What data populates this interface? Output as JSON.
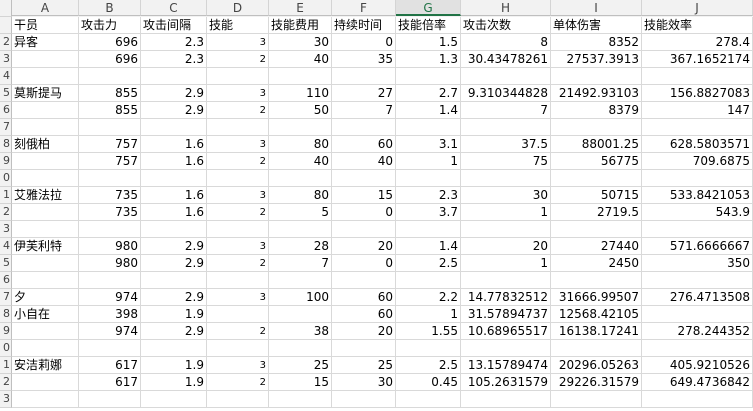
{
  "columns": [
    "A",
    "B",
    "C",
    "D",
    "E",
    "F",
    "G",
    "H",
    "I",
    "J"
  ],
  "selected_column": "G",
  "row_numbers": [
    "",
    "2",
    "3",
    "4",
    "5",
    "6",
    "7",
    "8",
    "9",
    "0",
    "1",
    "2",
    "3",
    "4",
    "5",
    "6",
    "7",
    "8",
    "9",
    "0",
    "1",
    "2",
    "3"
  ],
  "rows": [
    [
      "干员",
      "攻击力",
      "攻击间隔",
      "技能",
      "技能费用",
      "持续时间",
      "技能倍率",
      "攻击次数",
      "单体伤害",
      "技能效率"
    ],
    [
      "异客",
      "696",
      "2.3",
      "3",
      "30",
      "0",
      "1.5",
      "8",
      "8352",
      "278.4"
    ],
    [
      "",
      "696",
      "2.3",
      "2",
      "40",
      "35",
      "1.3",
      "30.43478261",
      "27537.3913",
      "367.1652174"
    ],
    [
      "",
      "",
      "",
      "",
      "",
      "",
      "",
      "",
      "",
      ""
    ],
    [
      "莫斯提马",
      "855",
      "2.9",
      "3",
      "110",
      "27",
      "2.7",
      "9.310344828",
      "21492.93103",
      "156.8827083"
    ],
    [
      "",
      "855",
      "2.9",
      "2",
      "50",
      "7",
      "1.4",
      "7",
      "8379",
      "147"
    ],
    [
      "",
      "",
      "",
      "",
      "",
      "",
      "",
      "",
      "",
      ""
    ],
    [
      "刻俄柏",
      "757",
      "1.6",
      "3",
      "80",
      "60",
      "3.1",
      "37.5",
      "88001.25",
      "628.5803571"
    ],
    [
      "",
      "757",
      "1.6",
      "2",
      "40",
      "40",
      "1",
      "75",
      "56775",
      "709.6875"
    ],
    [
      "",
      "",
      "",
      "",
      "",
      "",
      "",
      "",
      "",
      ""
    ],
    [
      "艾雅法拉",
      "735",
      "1.6",
      "3",
      "80",
      "15",
      "2.3",
      "30",
      "50715",
      "533.8421053"
    ],
    [
      "",
      "735",
      "1.6",
      "2",
      "5",
      "0",
      "3.7",
      "1",
      "2719.5",
      "543.9"
    ],
    [
      "",
      "",
      "",
      "",
      "",
      "",
      "",
      "",
      "",
      ""
    ],
    [
      "伊芙利特",
      "980",
      "2.9",
      "3",
      "28",
      "20",
      "1.4",
      "20",
      "27440",
      "571.6666667"
    ],
    [
      "",
      "980",
      "2.9",
      "2",
      "7",
      "0",
      "2.5",
      "1",
      "2450",
      "350"
    ],
    [
      "",
      "",
      "",
      "",
      "",
      "",
      "",
      "",
      "",
      ""
    ],
    [
      "夕",
      "974",
      "2.9",
      "3",
      "100",
      "60",
      "2.2",
      "14.77832512",
      "31666.99507",
      "276.4713508"
    ],
    [
      "小自在",
      "398",
      "1.9",
      "",
      "",
      "60",
      "1",
      "31.57894737",
      "12568.42105",
      ""
    ],
    [
      "",
      "974",
      "2.9",
      "2",
      "38",
      "20",
      "1.55",
      "10.68965517",
      "16138.17241",
      "278.244352"
    ],
    [
      "",
      "",
      "",
      "",
      "",
      "",
      "",
      "",
      "",
      ""
    ],
    [
      "安洁莉娜",
      "617",
      "1.9",
      "3",
      "25",
      "25",
      "2.5",
      "13.15789474",
      "20296.05263",
      "405.9210526"
    ],
    [
      "",
      "617",
      "1.9",
      "2",
      "15",
      "30",
      "0.45",
      "105.2631579",
      "29226.31579",
      "649.4736842"
    ],
    [
      "",
      "",
      "",
      "",
      "",
      "",
      "",
      "",
      "",
      ""
    ]
  ]
}
